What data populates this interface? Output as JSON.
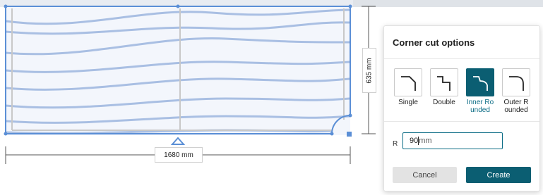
{
  "canvas": {
    "width_label": "1680 mm",
    "height_label": "635 mm",
    "shape_outline_color": "#5b8fd6",
    "wave_color": "#a9bfe3"
  },
  "panel": {
    "title": "Corner cut options",
    "options": [
      {
        "label": "Single",
        "icon": "single-corner-cut-icon",
        "selected": false
      },
      {
        "label": "Double",
        "icon": "double-corner-cut-icon",
        "selected": false
      },
      {
        "label": "Inner Rounded",
        "icon": "inner-rounded-corner-icon",
        "selected": true
      },
      {
        "label": "Outer Rounded",
        "icon": "outer-rounded-corner-icon",
        "selected": false
      }
    ],
    "radius": {
      "label": "R",
      "value": "90",
      "unit": "mm"
    },
    "cancel_label": "Cancel",
    "create_label": "Create",
    "accent_color": "#0b5e72"
  }
}
